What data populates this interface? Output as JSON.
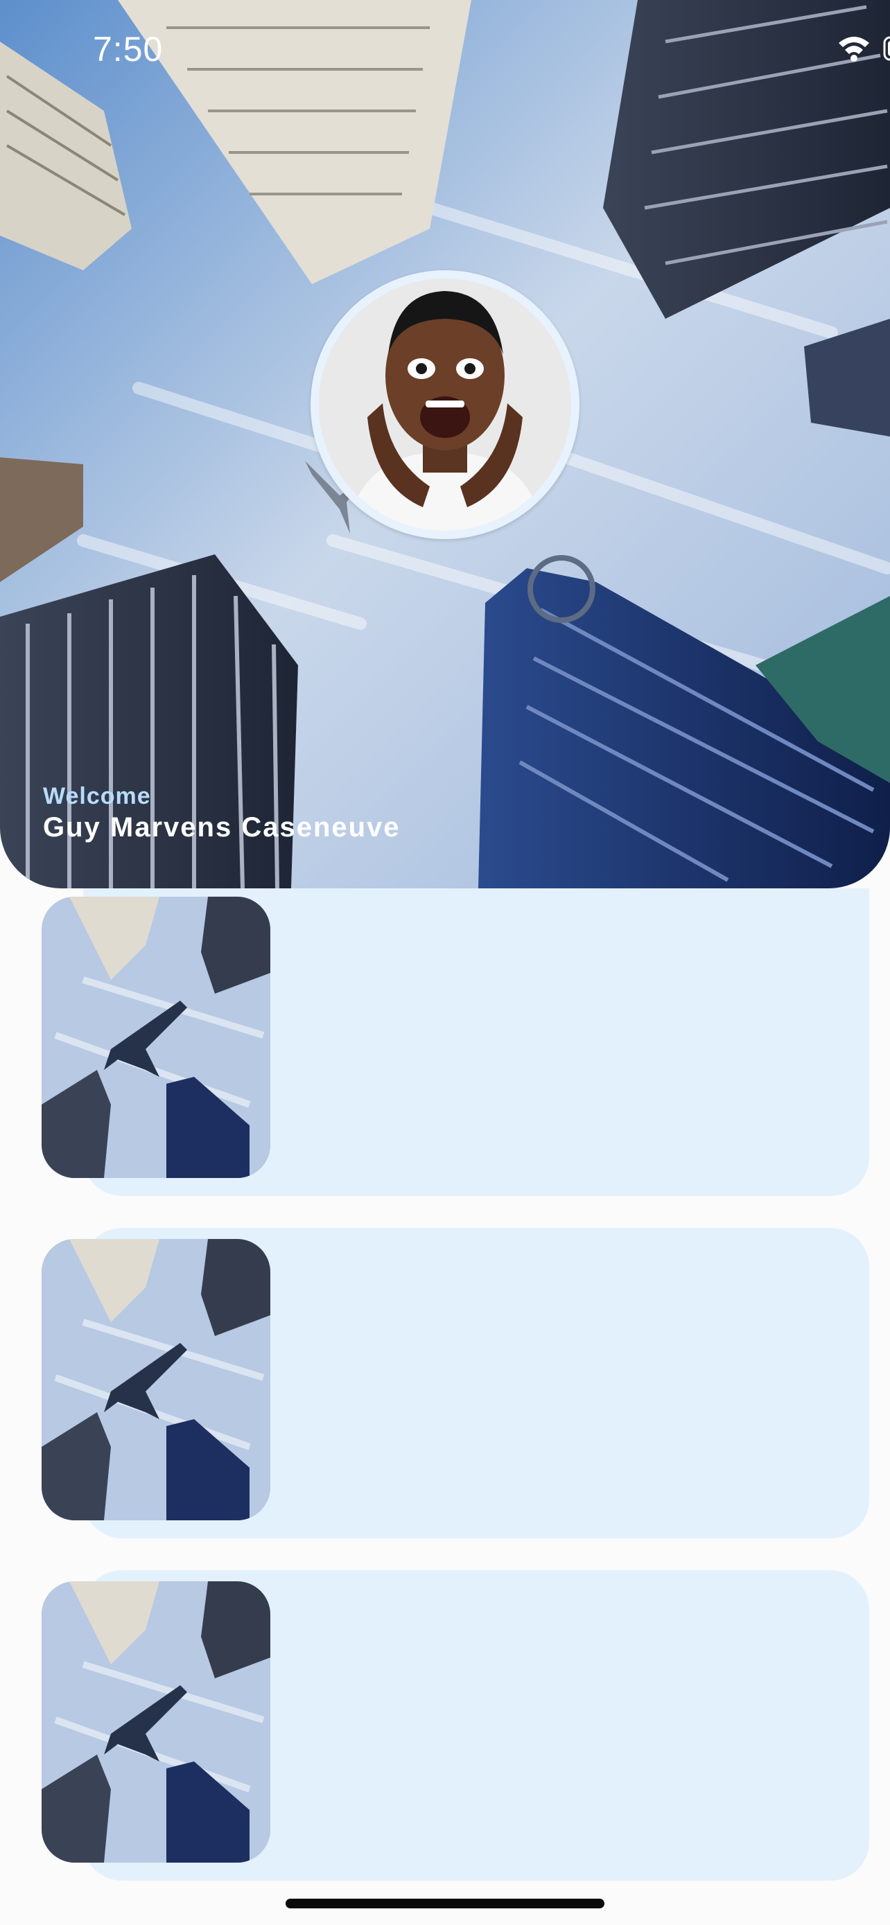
{
  "status_bar": {
    "time": "7:50"
  },
  "profile": {
    "greeting": "Welcome",
    "name": "Guy Marvens Caseneuve"
  },
  "cards": [
    {
      "label": ""
    },
    {
      "label": ""
    },
    {
      "label": ""
    }
  ],
  "colors": {
    "card_background": "#e3f1fd",
    "page_background": "#fbfbfb",
    "greeting": "#b8dcfb"
  },
  "icons": [
    "wifi-icon",
    "battery-icon",
    "airplane-icon"
  ]
}
